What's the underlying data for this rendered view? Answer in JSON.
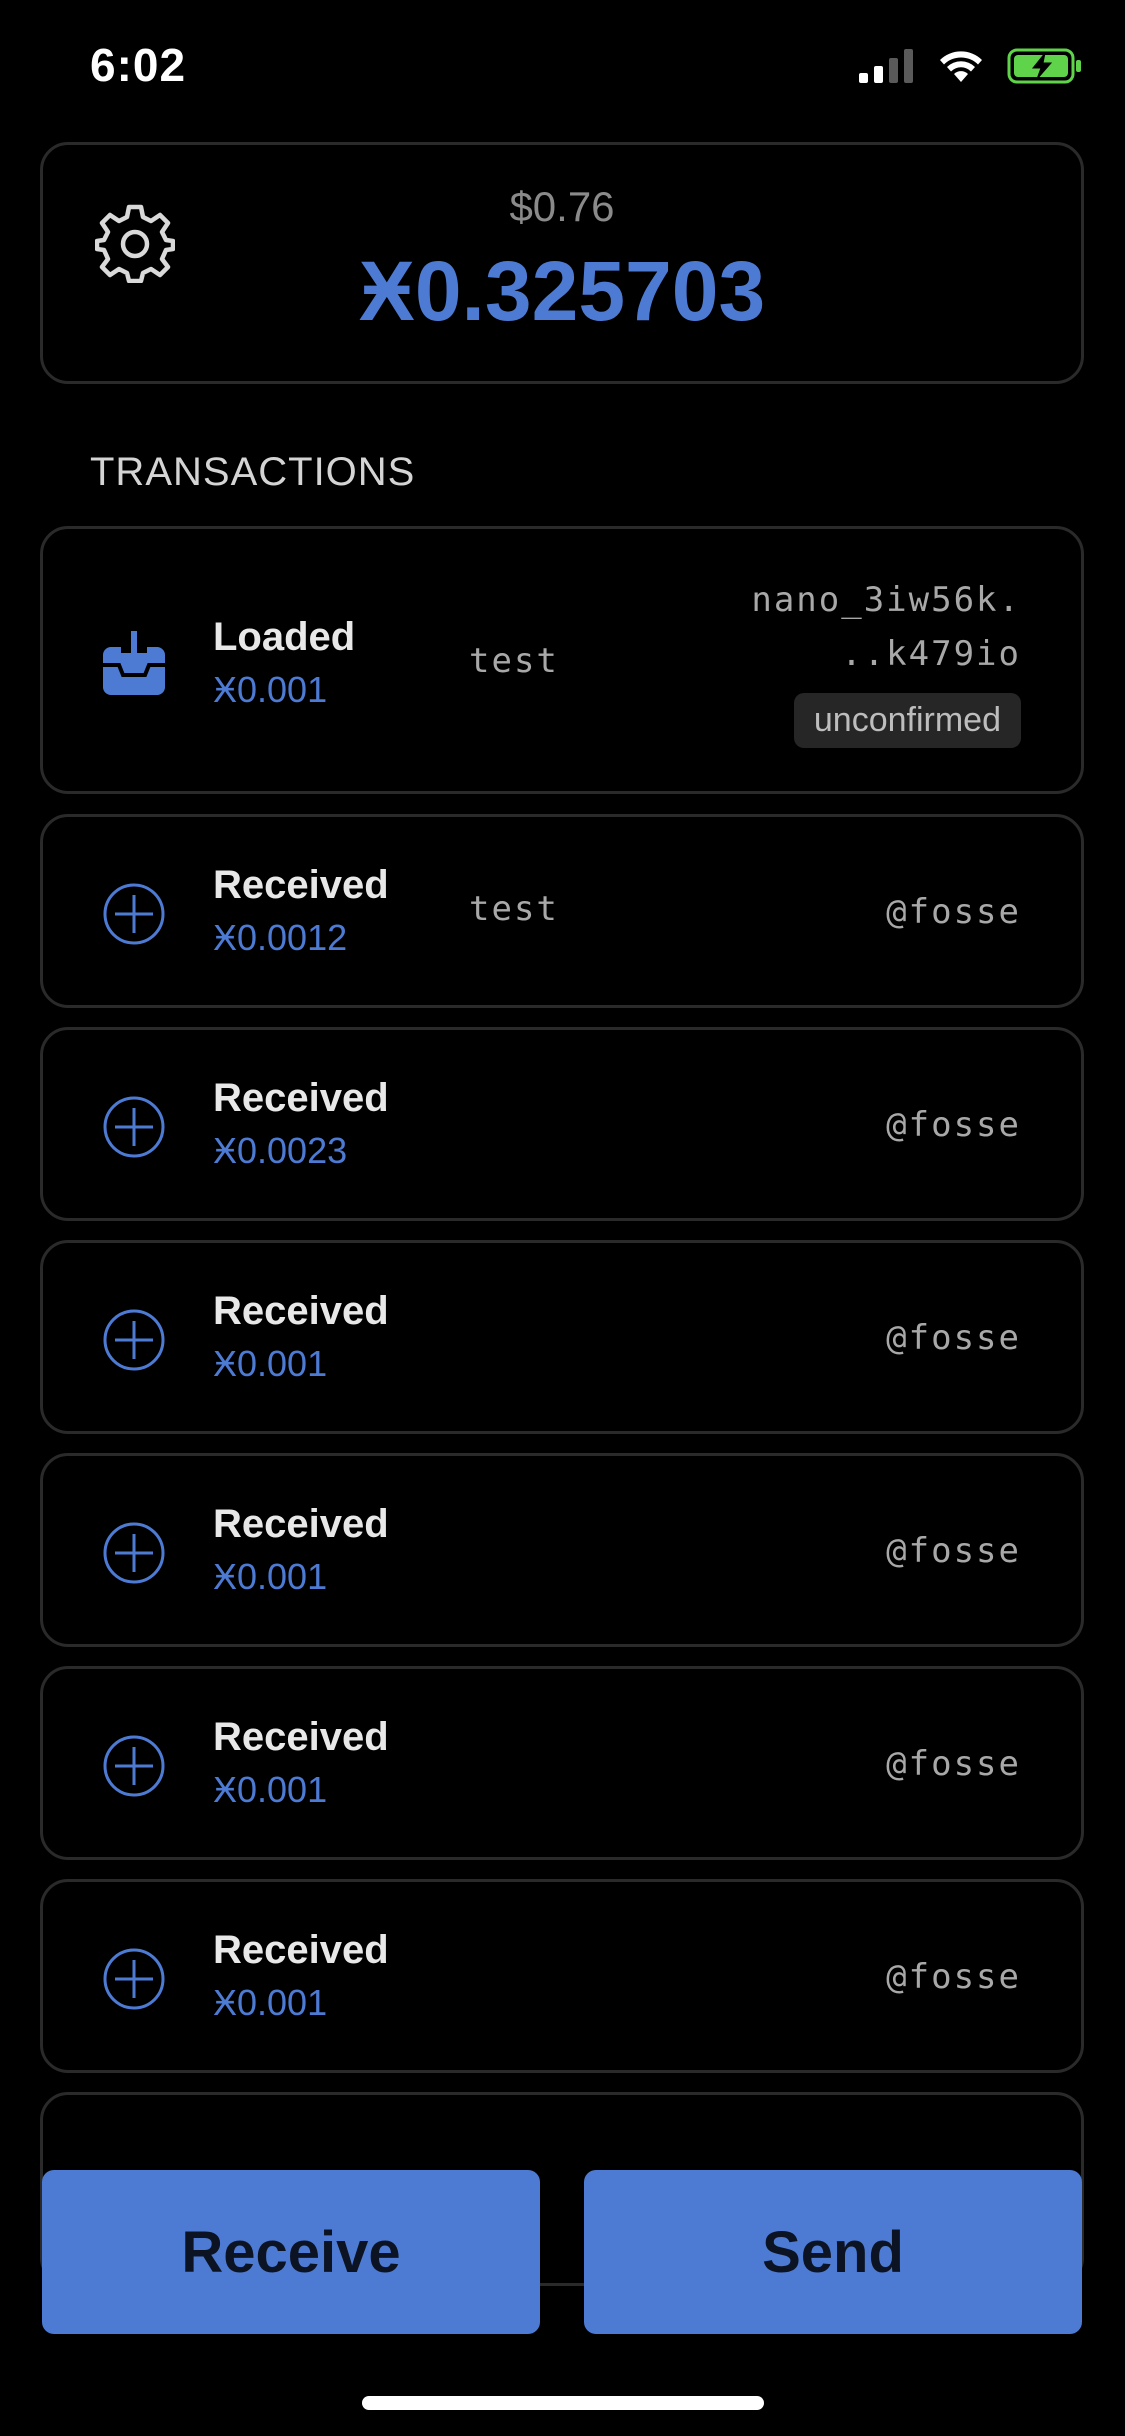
{
  "status_bar": {
    "time": "6:02"
  },
  "balance": {
    "fiat": "$0.76",
    "crypto": "Ӿ0.325703"
  },
  "section": {
    "title": "TRANSACTIONS"
  },
  "transactions": [
    {
      "type": "Loaded",
      "amount": "Ӿ0.001",
      "memo": "test",
      "party_line1": "nano_3iw56k.",
      "party_line2": "..k479io",
      "badge": "unconfirmed",
      "icon": "inbox-download-icon"
    },
    {
      "type": "Received",
      "amount": "Ӿ0.0012",
      "memo": "test",
      "party": "@fosse",
      "icon": "plus-circle-icon"
    },
    {
      "type": "Received",
      "amount": "Ӿ0.0023",
      "party": "@fosse",
      "icon": "plus-circle-icon"
    },
    {
      "type": "Received",
      "amount": "Ӿ0.001",
      "party": "@fosse",
      "icon": "plus-circle-icon"
    },
    {
      "type": "Received",
      "amount": "Ӿ0.001",
      "party": "@fosse",
      "icon": "plus-circle-icon"
    },
    {
      "type": "Received",
      "amount": "Ӿ0.001",
      "party": "@fosse",
      "icon": "plus-circle-icon"
    },
    {
      "type": "Received",
      "amount": "Ӿ0.001",
      "party": "@fosse",
      "icon": "plus-circle-icon"
    }
  ],
  "actions": {
    "receive": "Receive",
    "send": "Send"
  },
  "colors": {
    "accent": "#4d7bd4",
    "background": "#000000",
    "card_border": "#2a2a2a",
    "battery_green": "#5fd34a"
  }
}
